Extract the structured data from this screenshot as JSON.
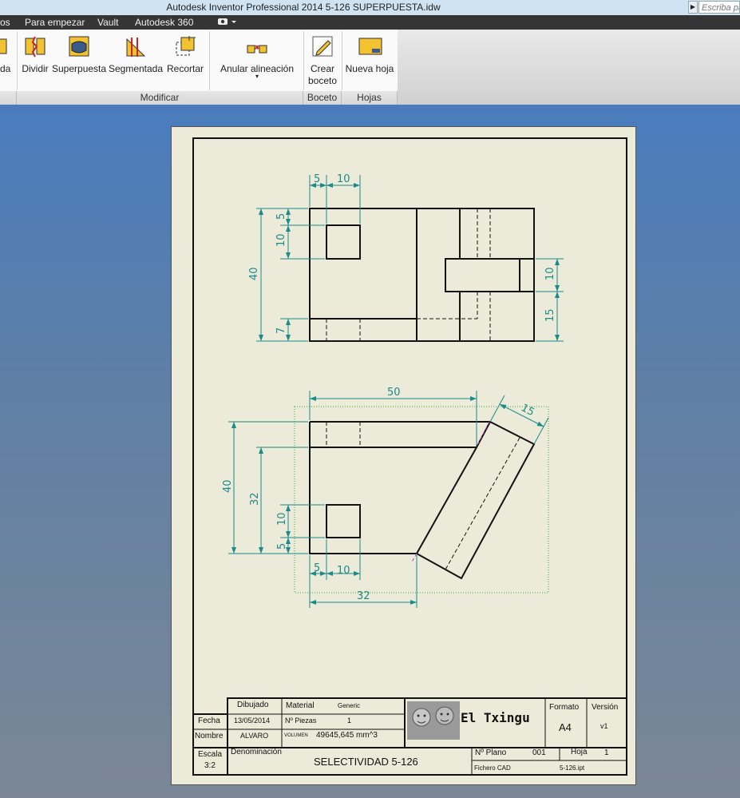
{
  "window": {
    "title": "Autodesk Inventor Professional 2014    5-126 SUPERPUESTA.idw"
  },
  "search": {
    "placeholder": "Escriba pa"
  },
  "menu": {
    "items": [
      "os",
      "Para empezar",
      "Vault",
      "Autodesk 360"
    ]
  },
  "ribbon": {
    "buttons": {
      "partial": "da",
      "dividir": "Dividir",
      "superpuesta": "Superpuesta",
      "segmentada": "Segmentada",
      "recortar": "Recortar",
      "anular": "Anular alineación",
      "crear_boceto": [
        "Crear",
        "boceto"
      ],
      "nueva_hoja": "Nueva hoja"
    },
    "groups": {
      "modificar": "Modificar",
      "boceto": "Boceto",
      "hojas": "Hojas"
    }
  },
  "colors": {
    "dimension": "#1a8a8a",
    "sheet": "#ecebd9",
    "menubar": "#353535",
    "titlebar": "#cfe3f3"
  },
  "drawing": {
    "top_view_dims": {
      "w5": "5",
      "w10": "10",
      "h5": "5",
      "h10": "10",
      "h40": "40",
      "h7": "7",
      "r10": "10",
      "r15": "15"
    },
    "bottom_view_dims": {
      "top50": "50",
      "diag15": "15",
      "h40": "40",
      "h32": "32",
      "h10": "10",
      "h5": "5",
      "w5": "5",
      "w10": "10",
      "w32": "32"
    }
  },
  "title_block": {
    "dibujado": "Dibujado",
    "fecha_label": "Fecha",
    "fecha": "13/05/2014",
    "nombre_label": "Nombre",
    "nombre": "ALVARO",
    "material_label": "Material",
    "material": "Generic",
    "piezas_label": "Nº Piezas",
    "piezas": "1",
    "volumen_label": "VOLUMEN",
    "volumen": "49645,645 mm^3",
    "logo": "El Txingu",
    "formato_label": "Formato",
    "formato": "A4",
    "version_label": "Versión",
    "version": "v1",
    "escala_label": "Escala",
    "escala": "3:2",
    "denominacion_label": "Denominación",
    "denominacion": "SELECTIVIDAD 5-126",
    "plano_label": "Nº Plano",
    "plano": "001",
    "hoja_label": "Hoja",
    "hoja": "1",
    "fichero_label": "Fichero CAD",
    "fichero": "5-126.ipt"
  }
}
